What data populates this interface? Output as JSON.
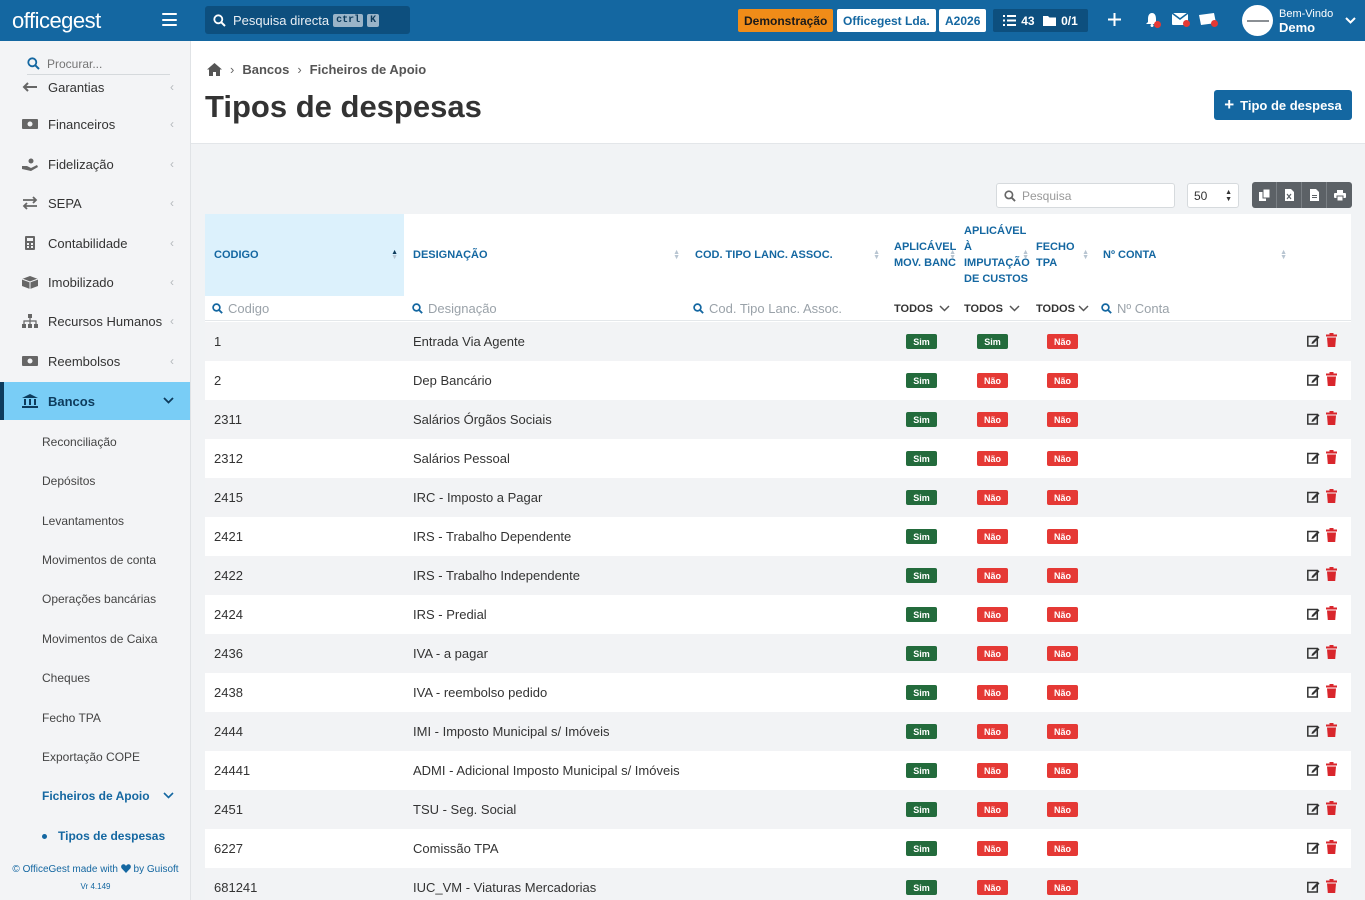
{
  "topbar": {
    "logo": "officegest",
    "search_placeholder": "Pesquisa directa",
    "kbd_ctrl": "ctrl",
    "kbd_k": "K",
    "demo_badge": "Demonstração",
    "company": "Officegest Lda.",
    "year": "A2026",
    "tasks_count": "43",
    "folder_count": "0/1",
    "greeting": "Bem-Vindo",
    "user": "Demo"
  },
  "sidebar": {
    "search_placeholder": "Procurar...",
    "items": [
      {
        "label": "Garantias",
        "icon": "back-arrow-icon"
      },
      {
        "label": "Financeiros",
        "icon": "money-icon"
      },
      {
        "label": "Fidelização",
        "icon": "hand-icon"
      },
      {
        "label": "SEPA",
        "icon": "exchange-icon"
      },
      {
        "label": "Contabilidade",
        "icon": "calculator-icon"
      },
      {
        "label": "Imobilizado",
        "icon": "box-icon"
      },
      {
        "label": "Recursos Humanos",
        "icon": "sitemap-icon"
      },
      {
        "label": "Reembolsos",
        "icon": "money-icon"
      },
      {
        "label": "Bancos",
        "icon": "bank-icon"
      }
    ],
    "sub_items": [
      "Reconciliação",
      "Depósitos",
      "Levantamentos",
      "Movimentos de conta",
      "Operações bancárias",
      "Movimentos de Caixa",
      "Cheques",
      "Fecho TPA",
      "Exportação COPE",
      "Ficheiros de Apoio"
    ],
    "subsub_item": "Tipos de despesas",
    "footer": "© OfficeGest made with",
    "footer_by": "by Guisoft",
    "version": "Vr 4.149"
  },
  "breadcrumb": [
    "Bancos",
    "Ficheiros de Apoio"
  ],
  "page_title": "Tipos de despesas",
  "add_button": "Tipo de despesa",
  "table_tools": {
    "search_placeholder": "Pesquisa",
    "page_size": "50"
  },
  "table": {
    "headers": {
      "codigo": "CODIGO",
      "designacao": "DESIGNAÇÃO",
      "cod_tipo": "COD. TIPO LANC. ASSOC.",
      "aplic_mov_1": "APLICÁVEL",
      "aplic_mov_2": "MOV. BANC",
      "aplic_imp_1": "APLICÁVEL",
      "aplic_imp_2": "À",
      "aplic_imp_3": "IMPUTAÇÃO",
      "aplic_imp_4": "DE CUSTOS",
      "fecho_1": "FECHO",
      "fecho_2": "TPA",
      "conta": "Nº CONTA"
    },
    "filters": {
      "codigo": "Codigo",
      "designacao": "Designação",
      "cod_tipo": "Cod. Tipo Lanc. Assoc.",
      "todos": "TODOS",
      "conta": "Nº Conta"
    },
    "yes": "Sim",
    "no": "Não",
    "rows": [
      {
        "codigo": "1",
        "designacao": "Entrada Via Agente",
        "mov": true,
        "imp": true,
        "fecho": false
      },
      {
        "codigo": "2",
        "designacao": "Dep Bancário",
        "mov": true,
        "imp": false,
        "fecho": false
      },
      {
        "codigo": "2311",
        "designacao": "Salários Órgãos Sociais",
        "mov": true,
        "imp": false,
        "fecho": false
      },
      {
        "codigo": "2312",
        "designacao": "Salários Pessoal",
        "mov": true,
        "imp": false,
        "fecho": false
      },
      {
        "codigo": "2415",
        "designacao": "IRC - Imposto a Pagar",
        "mov": true,
        "imp": false,
        "fecho": false
      },
      {
        "codigo": "2421",
        "designacao": "IRS - Trabalho Dependente",
        "mov": true,
        "imp": false,
        "fecho": false
      },
      {
        "codigo": "2422",
        "designacao": "IRS - Trabalho Independente",
        "mov": true,
        "imp": false,
        "fecho": false
      },
      {
        "codigo": "2424",
        "designacao": "IRS - Predial",
        "mov": true,
        "imp": false,
        "fecho": false
      },
      {
        "codigo": "2436",
        "designacao": "IVA - a pagar",
        "mov": true,
        "imp": false,
        "fecho": false
      },
      {
        "codigo": "2438",
        "designacao": "IVA - reembolso pedido",
        "mov": true,
        "imp": false,
        "fecho": false
      },
      {
        "codigo": "2444",
        "designacao": "IMI - Imposto Municipal s/ Imóveis",
        "mov": true,
        "imp": false,
        "fecho": false
      },
      {
        "codigo": "24441",
        "designacao": "ADMI - Adicional Imposto Municipal s/ Imóveis",
        "mov": true,
        "imp": false,
        "fecho": false
      },
      {
        "codigo": "2451",
        "designacao": "TSU - Seg. Social",
        "mov": true,
        "imp": false,
        "fecho": false
      },
      {
        "codigo": "6227",
        "designacao": "Comissão TPA",
        "mov": true,
        "imp": false,
        "fecho": false
      },
      {
        "codigo": "681241",
        "designacao": "IUC_VM - Viaturas Mercadorias",
        "mov": true,
        "imp": false,
        "fecho": false
      }
    ]
  }
}
